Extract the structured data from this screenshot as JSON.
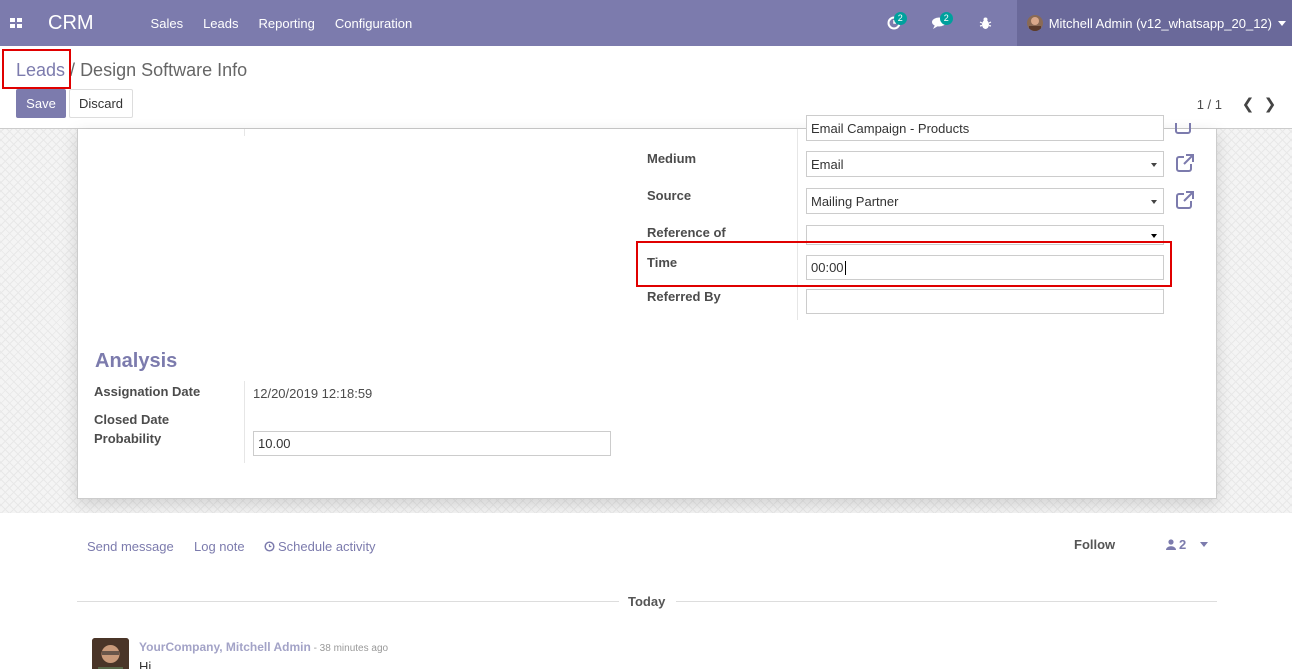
{
  "navbar": {
    "brand": "CRM",
    "menu": [
      "Sales",
      "Leads",
      "Reporting",
      "Configuration"
    ],
    "activity_badge": "2",
    "messages_badge": "2",
    "user_name": "Mitchell Admin (v12_whatsapp_20_12)",
    "accent_color": "#7c7bad"
  },
  "breadcrumb": {
    "parent": "Leads",
    "separator": " / ",
    "current": "Design Software Info"
  },
  "toolbar": {
    "save_label": "Save",
    "discard_label": "Discard",
    "pager": "1 / 1"
  },
  "form": {
    "campaign_value": "Email Campaign - Products",
    "medium_label": "Medium",
    "medium_value": "Email",
    "source_label": "Source",
    "source_value": "Mailing Partner",
    "reference_label": "Reference of",
    "reference_value": "",
    "time_label": "Time",
    "time_value": "00:00",
    "referred_label": "Referred By",
    "referred_value": ""
  },
  "analysis": {
    "title": "Analysis",
    "assignation_label": "Assignation Date",
    "assignation_value": "12/20/2019 12:18:59",
    "closed_label": "Closed Date",
    "closed_value": "",
    "probability_label": "Probability",
    "probability_value": "10.00"
  },
  "chatter": {
    "send_message": "Send message",
    "log_note": "Log note",
    "schedule_activity": "Schedule activity",
    "follow": "Follow",
    "followers_count": "2",
    "today": "Today",
    "message": {
      "author": "YourCompany, Mitchell Admin",
      "time": " - 38 minutes ago",
      "body": "Hi"
    }
  },
  "highlight_color": "#e00000"
}
